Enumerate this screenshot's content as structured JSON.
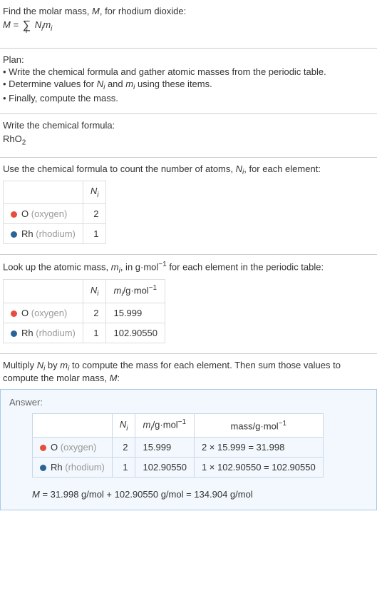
{
  "intro": {
    "line1": "Find the molar mass, ",
    "m": "M",
    "line1b": ", for rhodium dioxide:",
    "eq_lhs": "M = ",
    "eq_sum_sub": "i",
    "eq_rhs_a": "N",
    "eq_rhs_b": "m"
  },
  "plan": {
    "title": "Plan:",
    "b1": "• Write the chemical formula and gather atomic masses from the periodic table.",
    "b2_a": "• Determine values for ",
    "b2_n": "N",
    "b2_and": " and ",
    "b2_m": "m",
    "b2_end": " using these items.",
    "b3": "• Finally, compute the mass."
  },
  "formula": {
    "title": "Write the chemical formula:",
    "text": "RhO",
    "sub": "2"
  },
  "count": {
    "title_a": "Use the chemical formula to count the number of atoms, ",
    "title_n": "N",
    "title_b": ", for each element:",
    "header_n": "N",
    "o_sym": "O ",
    "o_name": "(oxygen)",
    "o_val": "2",
    "rh_sym": "Rh ",
    "rh_name": "(rhodium)",
    "rh_val": "1"
  },
  "mass": {
    "title_a": "Look up the atomic mass, ",
    "title_m": "m",
    "title_b": ", in g·mol",
    "title_sup": "−1",
    "title_c": " for each element in the periodic table:",
    "h_n": "N",
    "h_m": "m",
    "h_unit": "/g·mol",
    "h_sup": "−1",
    "o_n": "2",
    "o_m": "15.999",
    "rh_n": "1",
    "rh_m": "102.90550"
  },
  "multiply": {
    "line_a": "Multiply ",
    "line_n": "N",
    "line_by": " by ",
    "line_m": "m",
    "line_b": " to compute the mass for each element. Then sum those values to compute the molar mass, ",
    "line_mm": "M",
    "line_c": ":"
  },
  "answer": {
    "label": "Answer:",
    "h_n": "N",
    "h_m": "m",
    "h_unit": "/g·mol",
    "h_sup": "−1",
    "h_mass": "mass/g·mol",
    "o_n": "2",
    "o_m": "15.999",
    "o_calc": "2 × 15.999 = 31.998",
    "rh_n": "1",
    "rh_m": "102.90550",
    "rh_calc": "1 × 102.90550 = 102.90550",
    "final_lhs": "M",
    "final_rhs": " = 31.998 g/mol + 102.90550 g/mol = 134.904 g/mol"
  },
  "subscript_i": "i",
  "chart_data": {
    "type": "table",
    "title": "Molar mass calculation for RhO2",
    "elements": [
      {
        "element": "O (oxygen)",
        "N_i": 2,
        "m_i_g_per_mol": 15.999,
        "mass_g_per_mol": 31.998
      },
      {
        "element": "Rh (rhodium)",
        "N_i": 1,
        "m_i_g_per_mol": 102.9055,
        "mass_g_per_mol": 102.9055
      }
    ],
    "molar_mass_g_per_mol": 134.904
  }
}
